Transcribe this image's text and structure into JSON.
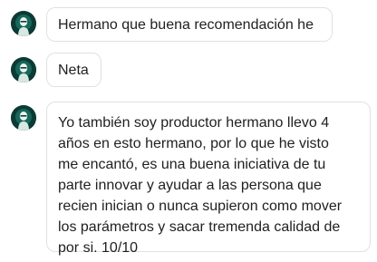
{
  "messages": [
    {
      "text": "Hermano que buena recomendación he"
    },
    {
      "text": "Neta"
    },
    {
      "text": "Yo también soy productor hermano llevo 4\naños en esto hermano, por lo que he visto\nme encantó, es una buena iniciativa de tu\nparte innovar y ayudar a las persona que\nrecien inician o nunca supieron como mover\nlos parámetros y sacar tremenda calidad de\npor si. 10/10"
    }
  ],
  "colors": {
    "background": "#ffffff",
    "bubble_border": "#e1e1e1",
    "avatar_teal": "#1f6f63",
    "text": "#1f1f1f"
  }
}
